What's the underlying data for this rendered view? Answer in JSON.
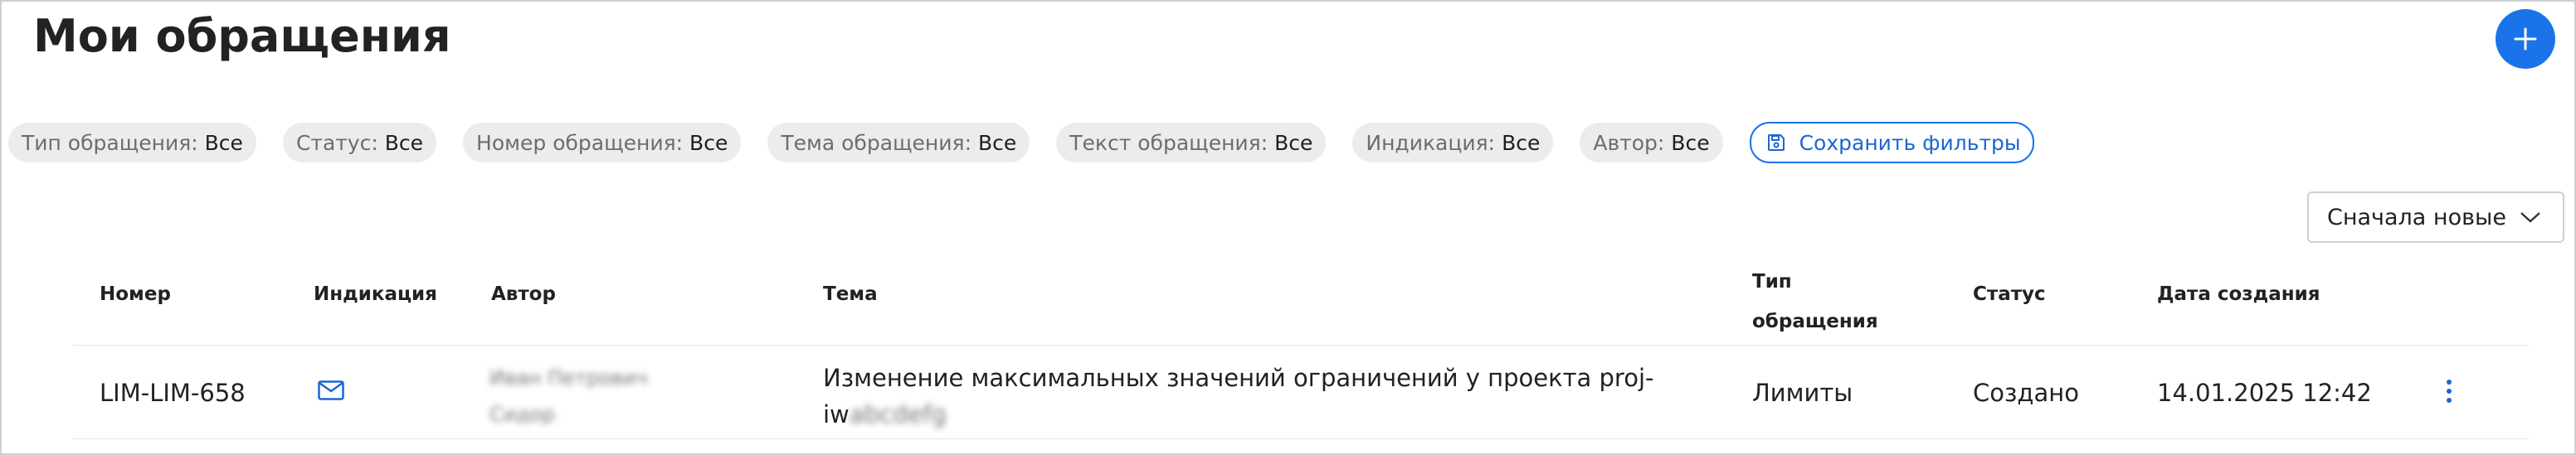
{
  "page": {
    "title": "Мои обращения"
  },
  "actions": {
    "add_icon": "plus-icon"
  },
  "filters": [
    {
      "key": "Тип обращения:",
      "value": "Все"
    },
    {
      "key": "Статус:",
      "value": "Все"
    },
    {
      "key": "Номер обращения:",
      "value": "Все"
    },
    {
      "key": "Тема обращения:",
      "value": "Все"
    },
    {
      "key": "Текст обращения:",
      "value": "Все"
    },
    {
      "key": "Индикация:",
      "value": "Все"
    },
    {
      "key": "Автор:",
      "value": "Все"
    }
  ],
  "save_filters": {
    "label": "Сохранить фильтры",
    "icon": "save-icon"
  },
  "sort": {
    "selected": "Сначала новые",
    "icon": "chevron-down-icon"
  },
  "table": {
    "columns": {
      "number": "Номер",
      "indication": "Индикация",
      "author": "Автор",
      "topic": "Тема",
      "type_line1": "Тип",
      "type_line2": "обращения",
      "status": "Статус",
      "created": "Дата создания"
    },
    "rows": [
      {
        "number": "LIM-LIM-658",
        "indication_icon": "mail-icon",
        "author_line1": "Иван Петрович",
        "author_line2": "Сидор",
        "topic_line1": "Изменение максимальных значений ограничений у проекта proj-",
        "topic_line2_prefix": "iw",
        "topic_line2_hidden": "abcdefg",
        "type": "Лимиты",
        "status": "Создано",
        "created": "14.01.2025 12:42",
        "menu_icon": "more-vertical-icon"
      }
    ]
  },
  "colors": {
    "accent": "#1a73e8",
    "chip_bg": "#ececec"
  }
}
